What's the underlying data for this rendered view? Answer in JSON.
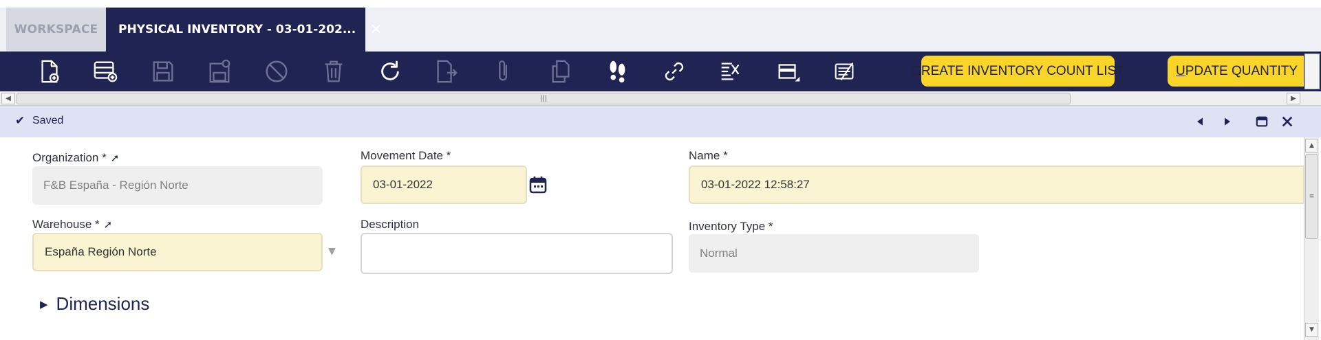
{
  "tabs": {
    "workspace_label": "WORKSPACE",
    "active_label": "PHYSICAL INVENTORY - 03-01-202...",
    "close_glyph": "×"
  },
  "toolbar": {
    "icons": [
      "new-document-icon",
      "new-row-icon",
      "save-icon",
      "save-close-icon",
      "cancel-icon",
      "delete-icon",
      "refresh-icon",
      "export-icon",
      "attachment-icon",
      "clone-icon",
      "audit-trail-icon",
      "link-icon",
      "print-icon",
      "grid-toggle-icon",
      "notes-icon"
    ],
    "create_count_prefix": "C",
    "create_count_rest": "REATE INVENTORY COUNT LIST",
    "update_qty_prefix": "U",
    "update_qty_rest": "PDATE QUANTITY",
    "accent_color": "#f9d52a",
    "bar_color": "#202452"
  },
  "status": {
    "text": "Saved"
  },
  "form": {
    "organization": {
      "label": "Organization *",
      "value": "F&B España - Región Norte"
    },
    "movement_date": {
      "label": "Movement Date *",
      "value": "03-01-2022"
    },
    "name": {
      "label": "Name *",
      "value": "03-01-2022 12:58:27"
    },
    "warehouse": {
      "label": "Warehouse *",
      "value": "España Región Norte"
    },
    "description": {
      "label": "Description",
      "value": ""
    },
    "inventory_type": {
      "label": "Inventory Type *",
      "value": "Normal"
    },
    "dimensions_label": "Dimensions"
  }
}
